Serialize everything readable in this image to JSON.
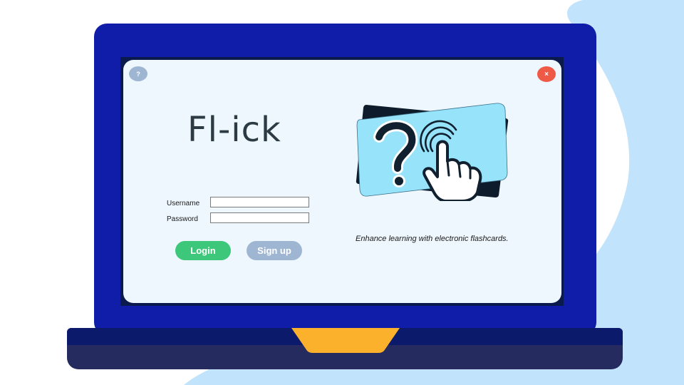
{
  "window": {
    "help_label": "?",
    "close_label": "×"
  },
  "app": {
    "title": "Fl-ick",
    "tagline": "Enhance learning with electronic flashcards."
  },
  "login_form": {
    "username_label": "Username",
    "username_value": "",
    "password_label": "Password",
    "password_value": "",
    "login_label": "Login",
    "signup_label": "Sign up"
  },
  "icons": {
    "illustration": "flashcard-question-tap-icon",
    "help": "question-mark-icon",
    "close": "close-icon"
  },
  "colors": {
    "laptop_frame": "#0f1da8",
    "window_background": "#eef7fd",
    "login_button": "#3dc77a",
    "signup_button": "#9fb6d3",
    "close_button": "#ee5a46",
    "card_front": "#96e3fa",
    "hinge_accent": "#fbb12b"
  }
}
